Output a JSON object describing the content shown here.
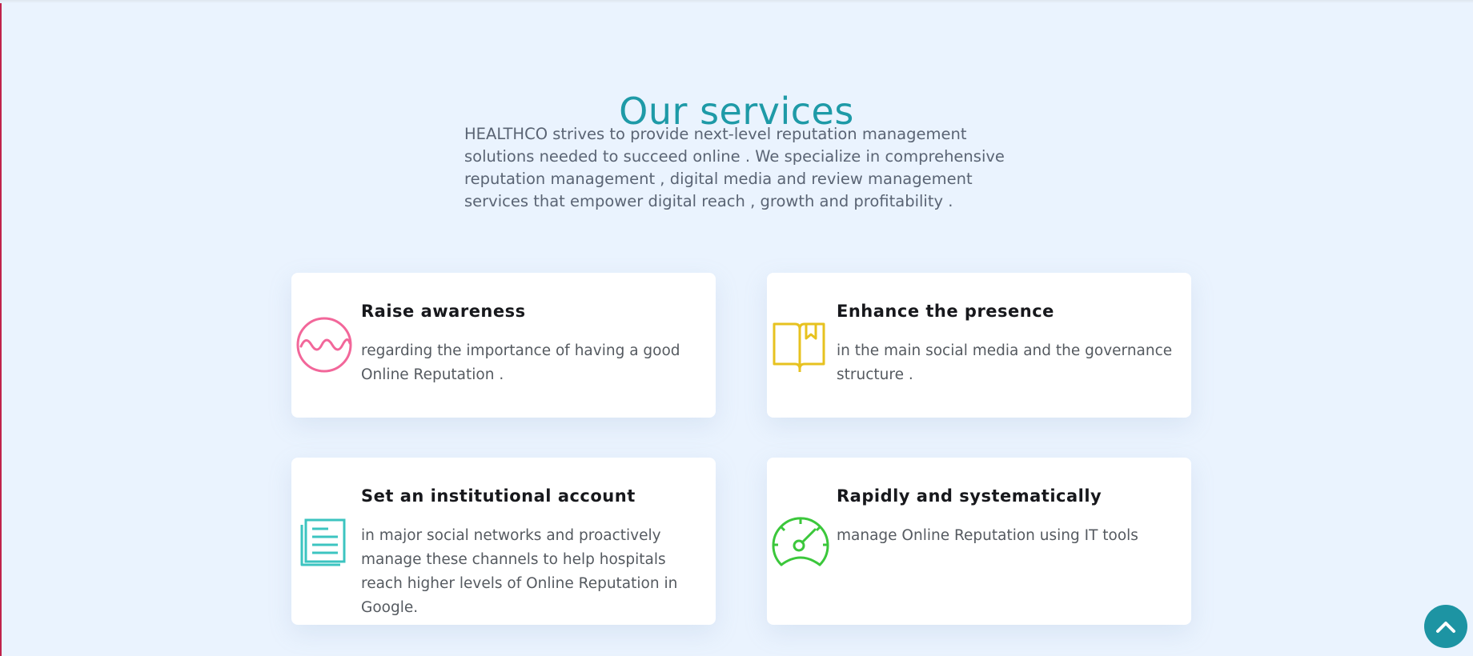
{
  "section": {
    "title": "Our services",
    "intro": "HEALTHCO strives to provide next-level reputation management solutions needed to succeed online . We specialize in comprehensive reputation management , digital media and review management services that empower digital reach , growth and profitability ."
  },
  "services": [
    {
      "title": "Raise awareness",
      "description": "regarding the importance of having a good Online Reputation .",
      "icon": "wave-circle-icon",
      "color": "#f2679a"
    },
    {
      "title": "Enhance the presence",
      "description": "in the main social media and the governance structure .",
      "icon": "book-icon",
      "color": "#e7c21f"
    },
    {
      "title": "Set an institutional account",
      "description": "in major social networks and proactively manage these channels to help hospitals reach higher levels of Online Reputation in Google.",
      "icon": "document-icon",
      "color": "#3cc4c0"
    },
    {
      "title": "Rapidly and systematically",
      "description": "manage Online Reputation using IT tools",
      "icon": "speedometer-icon",
      "color": "#3bc73b"
    }
  ],
  "scroll_top": {
    "icon": "chevron-up-icon",
    "color": "#1d94a3"
  }
}
